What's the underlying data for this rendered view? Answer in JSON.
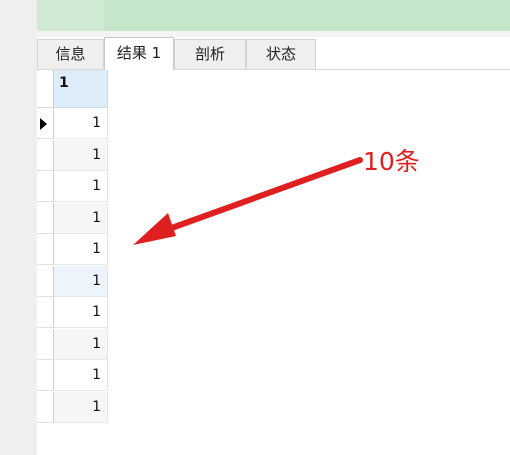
{
  "tabs": [
    {
      "label": "信息",
      "active": false
    },
    {
      "label": "结果 1",
      "active": true
    },
    {
      "label": "剖析",
      "active": false
    },
    {
      "label": "状态",
      "active": false
    }
  ],
  "grid": {
    "column_header": "1",
    "rows": [
      "1",
      "1",
      "1",
      "1",
      "1",
      "1",
      "1",
      "1",
      "1",
      "1"
    ],
    "current_row_index": 0
  },
  "annotation": {
    "text": "10条",
    "color": "#e02020"
  },
  "colors": {
    "top_band": "#c6e6c9",
    "header_cell": "#dcecf8"
  }
}
